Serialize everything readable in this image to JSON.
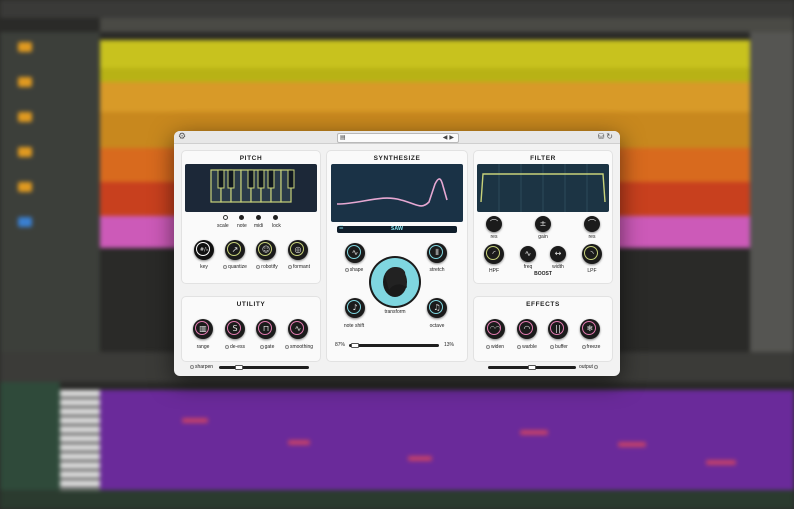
{
  "plugin": {
    "title_bar": {
      "menu_icon": "menu-icon",
      "nav_prev": "◀",
      "nav_next": "▶"
    },
    "pitch": {
      "title": "PITCH",
      "key_options": [
        "scale",
        "note",
        "midi",
        "lock"
      ],
      "knobs": [
        {
          "label": "key",
          "symbol": "#/♭"
        },
        {
          "label": "quantize",
          "symbol": "↗"
        },
        {
          "label": "robotify",
          "symbol": "☺"
        },
        {
          "label": "formant",
          "symbol": "◎"
        }
      ]
    },
    "utility": {
      "title": "UTILITY",
      "knobs": [
        {
          "label": "range",
          "symbol": "▥"
        },
        {
          "label": "de-ess",
          "symbol": "S"
        },
        {
          "label": "gate",
          "symbol": "⊓"
        },
        {
          "label": "smoothing",
          "symbol": "∿"
        }
      ],
      "sharpen_label": "sharpen"
    },
    "synthesize": {
      "title": "SYNTHESIZE",
      "waveform": "SAW",
      "knobs": [
        {
          "label": "shape",
          "symbol": "∿"
        },
        {
          "label": "stretch",
          "symbol": "⫴"
        },
        {
          "label": "note shift",
          "symbol": "♪"
        },
        {
          "label": "octave",
          "symbol": "♫"
        }
      ],
      "center_label": "transform",
      "left_pct": "87%",
      "right_pct": "13%"
    },
    "filter": {
      "title": "FILTER",
      "knobs": [
        {
          "label": "res",
          "symbol": "⌒"
        },
        {
          "label": "gain",
          "symbol": "±"
        },
        {
          "label": "res",
          "symbol": "⌒"
        },
        {
          "label": "HPF",
          "symbol": "◜"
        },
        {
          "label": "freq",
          "symbol": "∿"
        },
        {
          "label": "width",
          "symbol": "↔"
        },
        {
          "label": "LPF",
          "symbol": "◝"
        }
      ],
      "boost_label": "BOOST"
    },
    "effects": {
      "title": "EFFECTS",
      "knobs": [
        {
          "label": "widen",
          "symbol": "◠◠"
        },
        {
          "label": "warble",
          "symbol": "◠"
        },
        {
          "label": "buffer",
          "symbol": "||"
        },
        {
          "label": "freeze",
          "symbol": "❄"
        }
      ],
      "output_label": "output"
    },
    "colors": {
      "accent": "#c8d27a",
      "teal": "#7fd6e0",
      "pink": "#e27ab0",
      "screen": "#182838"
    }
  }
}
